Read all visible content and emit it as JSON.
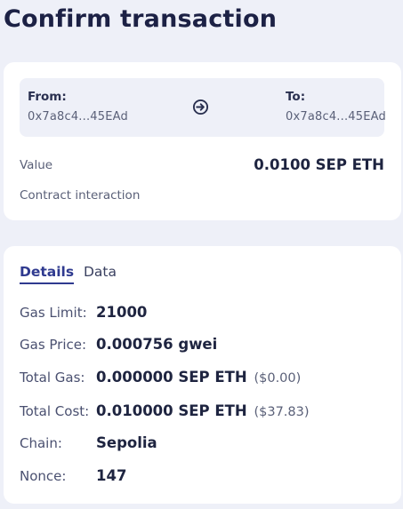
{
  "header": {
    "title": "Confirm transaction"
  },
  "summary": {
    "from_label": "From:",
    "from_address": "0x7a8c4...45EAd",
    "to_label": "To:",
    "to_address": "0x7a8c4...45EAd",
    "arrow_icon": "arrow-right-circle-icon",
    "value_label": "Value",
    "value_amount": "0.0100 SEP ETH",
    "contract_label": "Contract interaction"
  },
  "tabs": {
    "active": "Details",
    "items": [
      {
        "label": "Details"
      },
      {
        "label": "Data"
      }
    ]
  },
  "details": {
    "gas_limit": {
      "label": "Gas Limit:",
      "value": "21000"
    },
    "gas_price": {
      "label": "Gas Price:",
      "value": "0.000756 gwei"
    },
    "total_gas": {
      "label": "Total Gas:",
      "value": "0.000000 SEP ETH",
      "fiat": "($0.00)"
    },
    "total_cost": {
      "label": "Total Cost:",
      "value": "0.010000 SEP ETH",
      "fiat": "($37.83)"
    },
    "chain": {
      "label": "Chain:",
      "value": "Sepolia"
    },
    "nonce": {
      "label": "Nonce:",
      "value": "147"
    }
  },
  "colors": {
    "background": "#eef0f8",
    "card": "#ffffff",
    "accent": "#2f3a8f",
    "text_primary": "#1e2440",
    "text_secondary": "#5a6078"
  }
}
